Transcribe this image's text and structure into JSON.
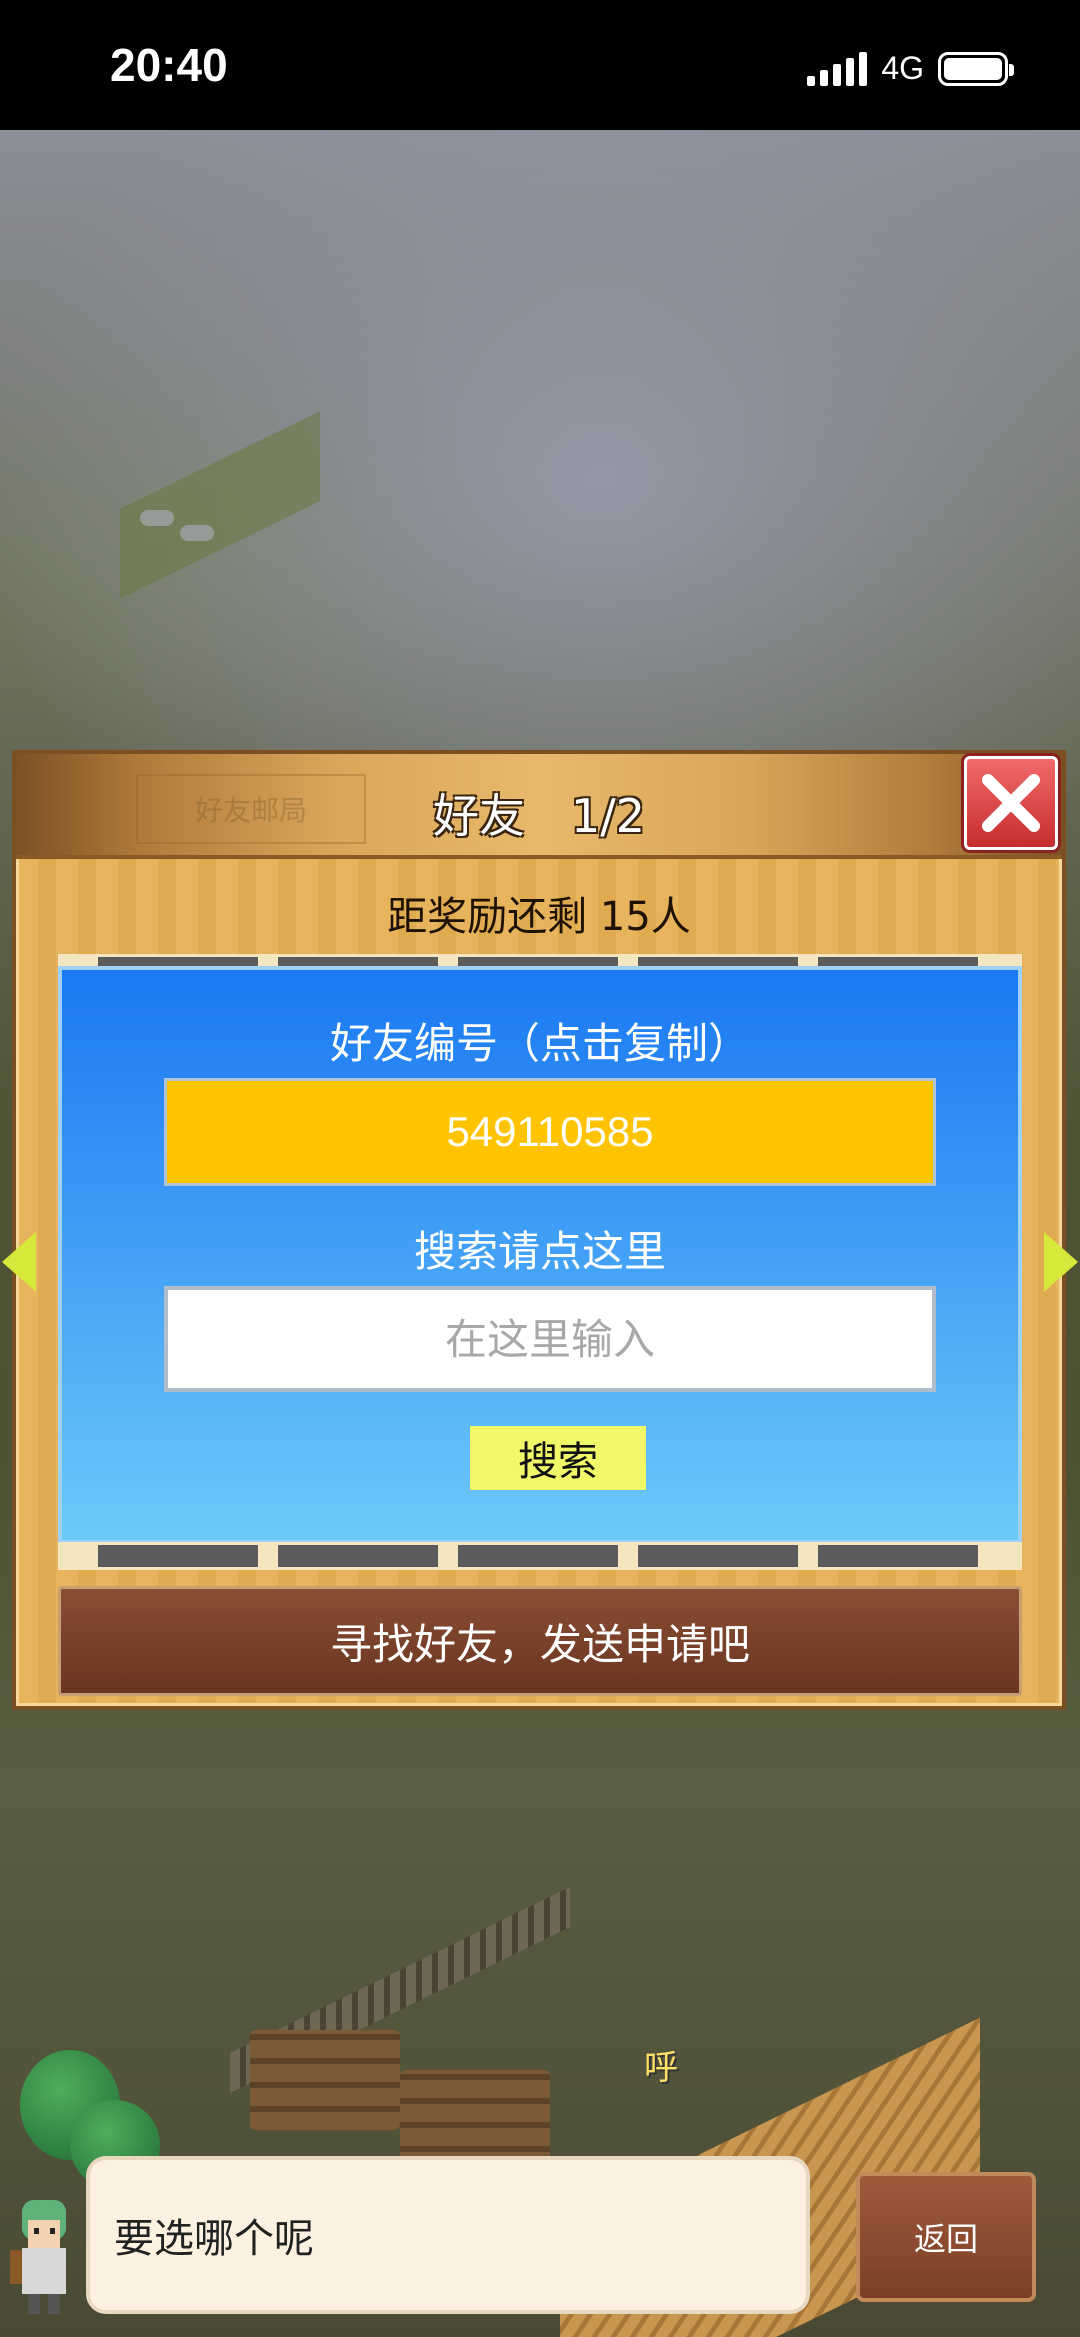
{
  "status_bar": {
    "time": "20:40",
    "network": "4G"
  },
  "dialog": {
    "header_ghost_label": "好友邮局",
    "title": "好友　1/2",
    "subtitle": "距奖励还剩 15人",
    "friend_id_heading": "好友编号（点击复制）",
    "friend_id_value": "549110585",
    "search_heading": "搜索请点这里",
    "search_placeholder": "在这里输入",
    "search_button": "搜索",
    "action_button": "寻找好友，发送申请吧",
    "close_icon": "close-icon",
    "colors": {
      "card_blue": "#1a78f2",
      "id_yellow": "#ffc300",
      "search_btn": "#f0f86a",
      "close_red": "#e04444"
    }
  },
  "bottom": {
    "speech_text": "要选哪个呢",
    "back_button": "返回",
    "shout_text": "呼"
  }
}
